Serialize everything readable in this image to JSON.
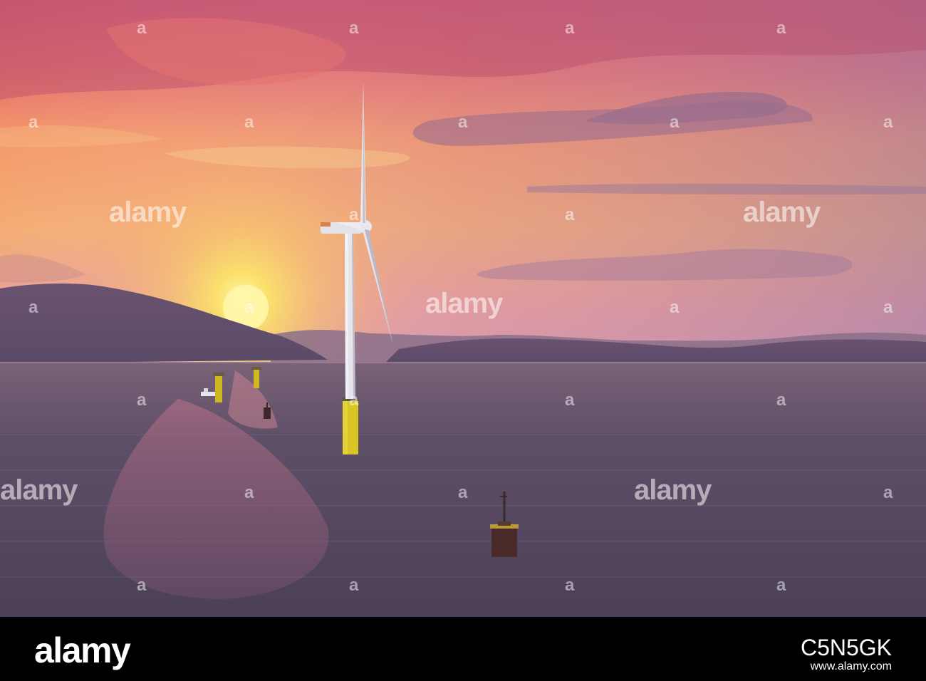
{
  "watermark": {
    "word": "alamy",
    "mark": "a"
  },
  "footer": {
    "brand": "alamy",
    "image_id": "C5N5GK",
    "url": "www.alamy.com"
  },
  "colors": {
    "sky_top": "#d8607e",
    "sky_glow": "#f7e066",
    "sea": "#554860",
    "turbine_yellow": "#d9c524",
    "turbine_white": "#e9e9ec"
  }
}
